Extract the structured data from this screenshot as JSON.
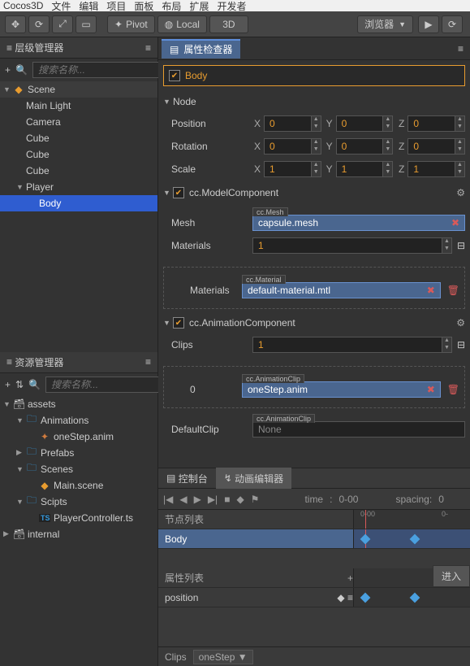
{
  "app": {
    "name": "Cocos3D",
    "menus": [
      "文件",
      "编辑",
      "项目",
      "面板",
      "布局",
      "扩展",
      "开发者"
    ]
  },
  "toolbar": {
    "pivot_label": "Pivot",
    "local_label": "Local",
    "mode_label": "3D",
    "browser_label": "浏览器"
  },
  "hierarchy": {
    "title": "层级管理器",
    "search_placeholder": "搜索名称...",
    "root": "Scene",
    "items": [
      {
        "label": "Main Light"
      },
      {
        "label": "Camera"
      },
      {
        "label": "Cube"
      },
      {
        "label": "Cube"
      },
      {
        "label": "Cube"
      },
      {
        "label": "Player"
      },
      {
        "label": "Body"
      }
    ]
  },
  "assets": {
    "title": "资源管理器",
    "search_placeholder": "搜索名称...",
    "items": [
      {
        "label": "assets"
      },
      {
        "label": "Animations"
      },
      {
        "label": "oneStep.anim"
      },
      {
        "label": "Prefabs"
      },
      {
        "label": "Scenes"
      },
      {
        "label": "Main.scene"
      },
      {
        "label": "Scipts"
      },
      {
        "label": "PlayerController.ts"
      },
      {
        "label": "internal"
      }
    ]
  },
  "inspector": {
    "title": "属性检查器",
    "node_name": "Body",
    "node_section": "Node",
    "position_label": "Position",
    "rotation_label": "Rotation",
    "scale_label": "Scale",
    "pos": {
      "x": "0",
      "y": "0",
      "z": "0"
    },
    "rot": {
      "x": "0",
      "y": "0",
      "z": "0"
    },
    "scale": {
      "x": "1",
      "y": "1",
      "z": "1"
    },
    "model": {
      "title": "cc.ModelComponent",
      "mesh_label": "Mesh",
      "mesh_tag": "cc.Mesh",
      "mesh_value": "capsule.mesh",
      "materials_label": "Materials",
      "materials_count": "1",
      "materials_sub_label": "Materials",
      "material_tag": "cc.Material",
      "material_value": "default-material.mtl"
    },
    "anim": {
      "title": "cc.AnimationComponent",
      "clips_label": "Clips",
      "clips_count": "1",
      "clip_index": "0",
      "clip_tag": "cc.AnimationClip",
      "clip_value": "oneStep.anim",
      "default_clip_label": "DefaultClip",
      "default_clip_tag": "cc.AnimationClip",
      "default_clip_value": "None"
    }
  },
  "bottom": {
    "console_tab": "控制台",
    "anim_editor_tab": "动画编辑器",
    "time_label": "time",
    "time_value": "0-00",
    "spacing_label": "spacing:",
    "spacing_value": "0",
    "node_list_label": "节点列表",
    "body_row": "Body",
    "prop_list_label": "属性列表",
    "position_row": "position",
    "enter_label": "进入",
    "ruler0": "0-00",
    "ruler1": "0-",
    "clips_label": "Clips",
    "clip_value": "oneStep"
  }
}
